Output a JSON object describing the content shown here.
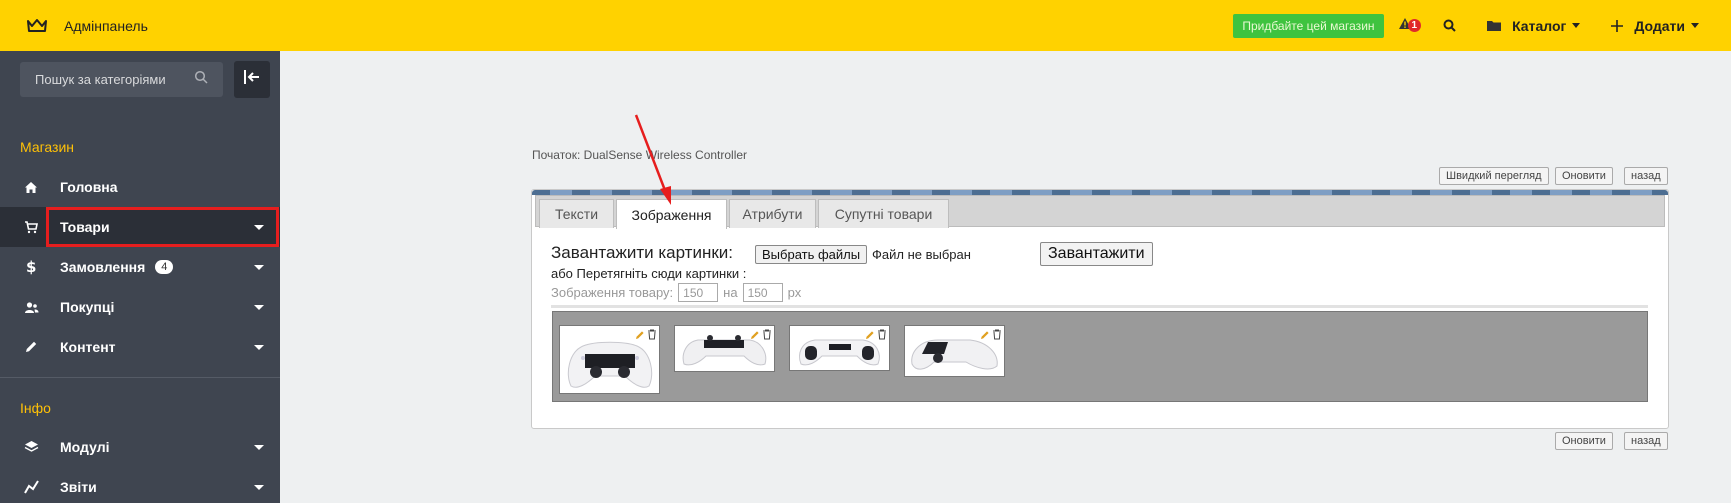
{
  "header": {
    "brand_label": "Адмінпанель",
    "promo_button": "Придбайте цей магазин",
    "alert_count": "1",
    "catalog_label": "Каталог",
    "add_label": "Додати"
  },
  "sidebar": {
    "search_placeholder": "Пошук за категоріями",
    "section_shop": "Магазин",
    "section_info": "Інфо",
    "items": [
      {
        "label": "Головна",
        "icon": "home-icon"
      },
      {
        "label": "Товари",
        "icon": "cart-icon"
      },
      {
        "label": "Замовлення",
        "icon": "dollar-icon",
        "badge": "4"
      },
      {
        "label": "Покупці",
        "icon": "users-icon"
      },
      {
        "label": "Контент",
        "icon": "pencil-icon"
      },
      {
        "label": "Модулі",
        "icon": "layers-icon"
      },
      {
        "label": "Звіти",
        "icon": "chart-icon"
      }
    ]
  },
  "main": {
    "breadcrumb": "Початок: DualSense Wireless Controller",
    "top_buttons": [
      "Швидкий перегляд",
      "Оновити",
      "назад"
    ],
    "bottom_buttons": [
      "Оновити",
      "назад"
    ],
    "tabs": [
      "Тексти",
      "Зображення",
      "Атрибути",
      "Супутні товари"
    ],
    "active_tab": "Зображення",
    "upload_title": "Завантажити картинки:",
    "file_button": "Выбрать файлы",
    "file_status": "Файл не выбран",
    "upload_button": "Завантажити",
    "drag_hint": "або Перетягніть сюди картинки :",
    "size_label": "Зображення товару:",
    "size_width": "150",
    "size_between": "на",
    "size_height": "150",
    "size_unit": "px"
  },
  "colors": {
    "topbar": "#ffd200",
    "sidebar": "#3f4550",
    "accent": "#ffc107",
    "highlight": "#e61e1e"
  }
}
